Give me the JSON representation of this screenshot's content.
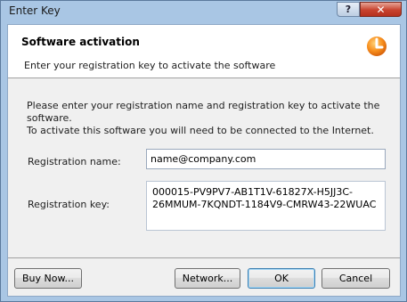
{
  "window": {
    "title": "Enter Key",
    "help_label": "?",
    "close_label": "✕"
  },
  "header": {
    "title": "Software activation",
    "subtitle": "Enter your registration key to activate the software",
    "logo_icon": "orange-clock-logo-icon"
  },
  "intro": {
    "line1": "Please enter your registration name and registration key to activate the software.",
    "line2": "To activate this software you will need to be connected to the Internet."
  },
  "form": {
    "name_label": "Registration name:",
    "name_value": "name@company.com",
    "key_label": "Registration key:",
    "key_value": "000015-PV9PV7-AB1T1V-61827X-H5JJ3C-26MMUM-7KQNDT-1184V9-CMRW43-22WUAC"
  },
  "buttons": {
    "buy_now": "Buy Now...",
    "network": "Network...",
    "ok": "OK",
    "cancel": "Cancel"
  },
  "colors": {
    "frame": "#a9c6e4",
    "close": "#c8432f",
    "logo": "#f47b16"
  }
}
